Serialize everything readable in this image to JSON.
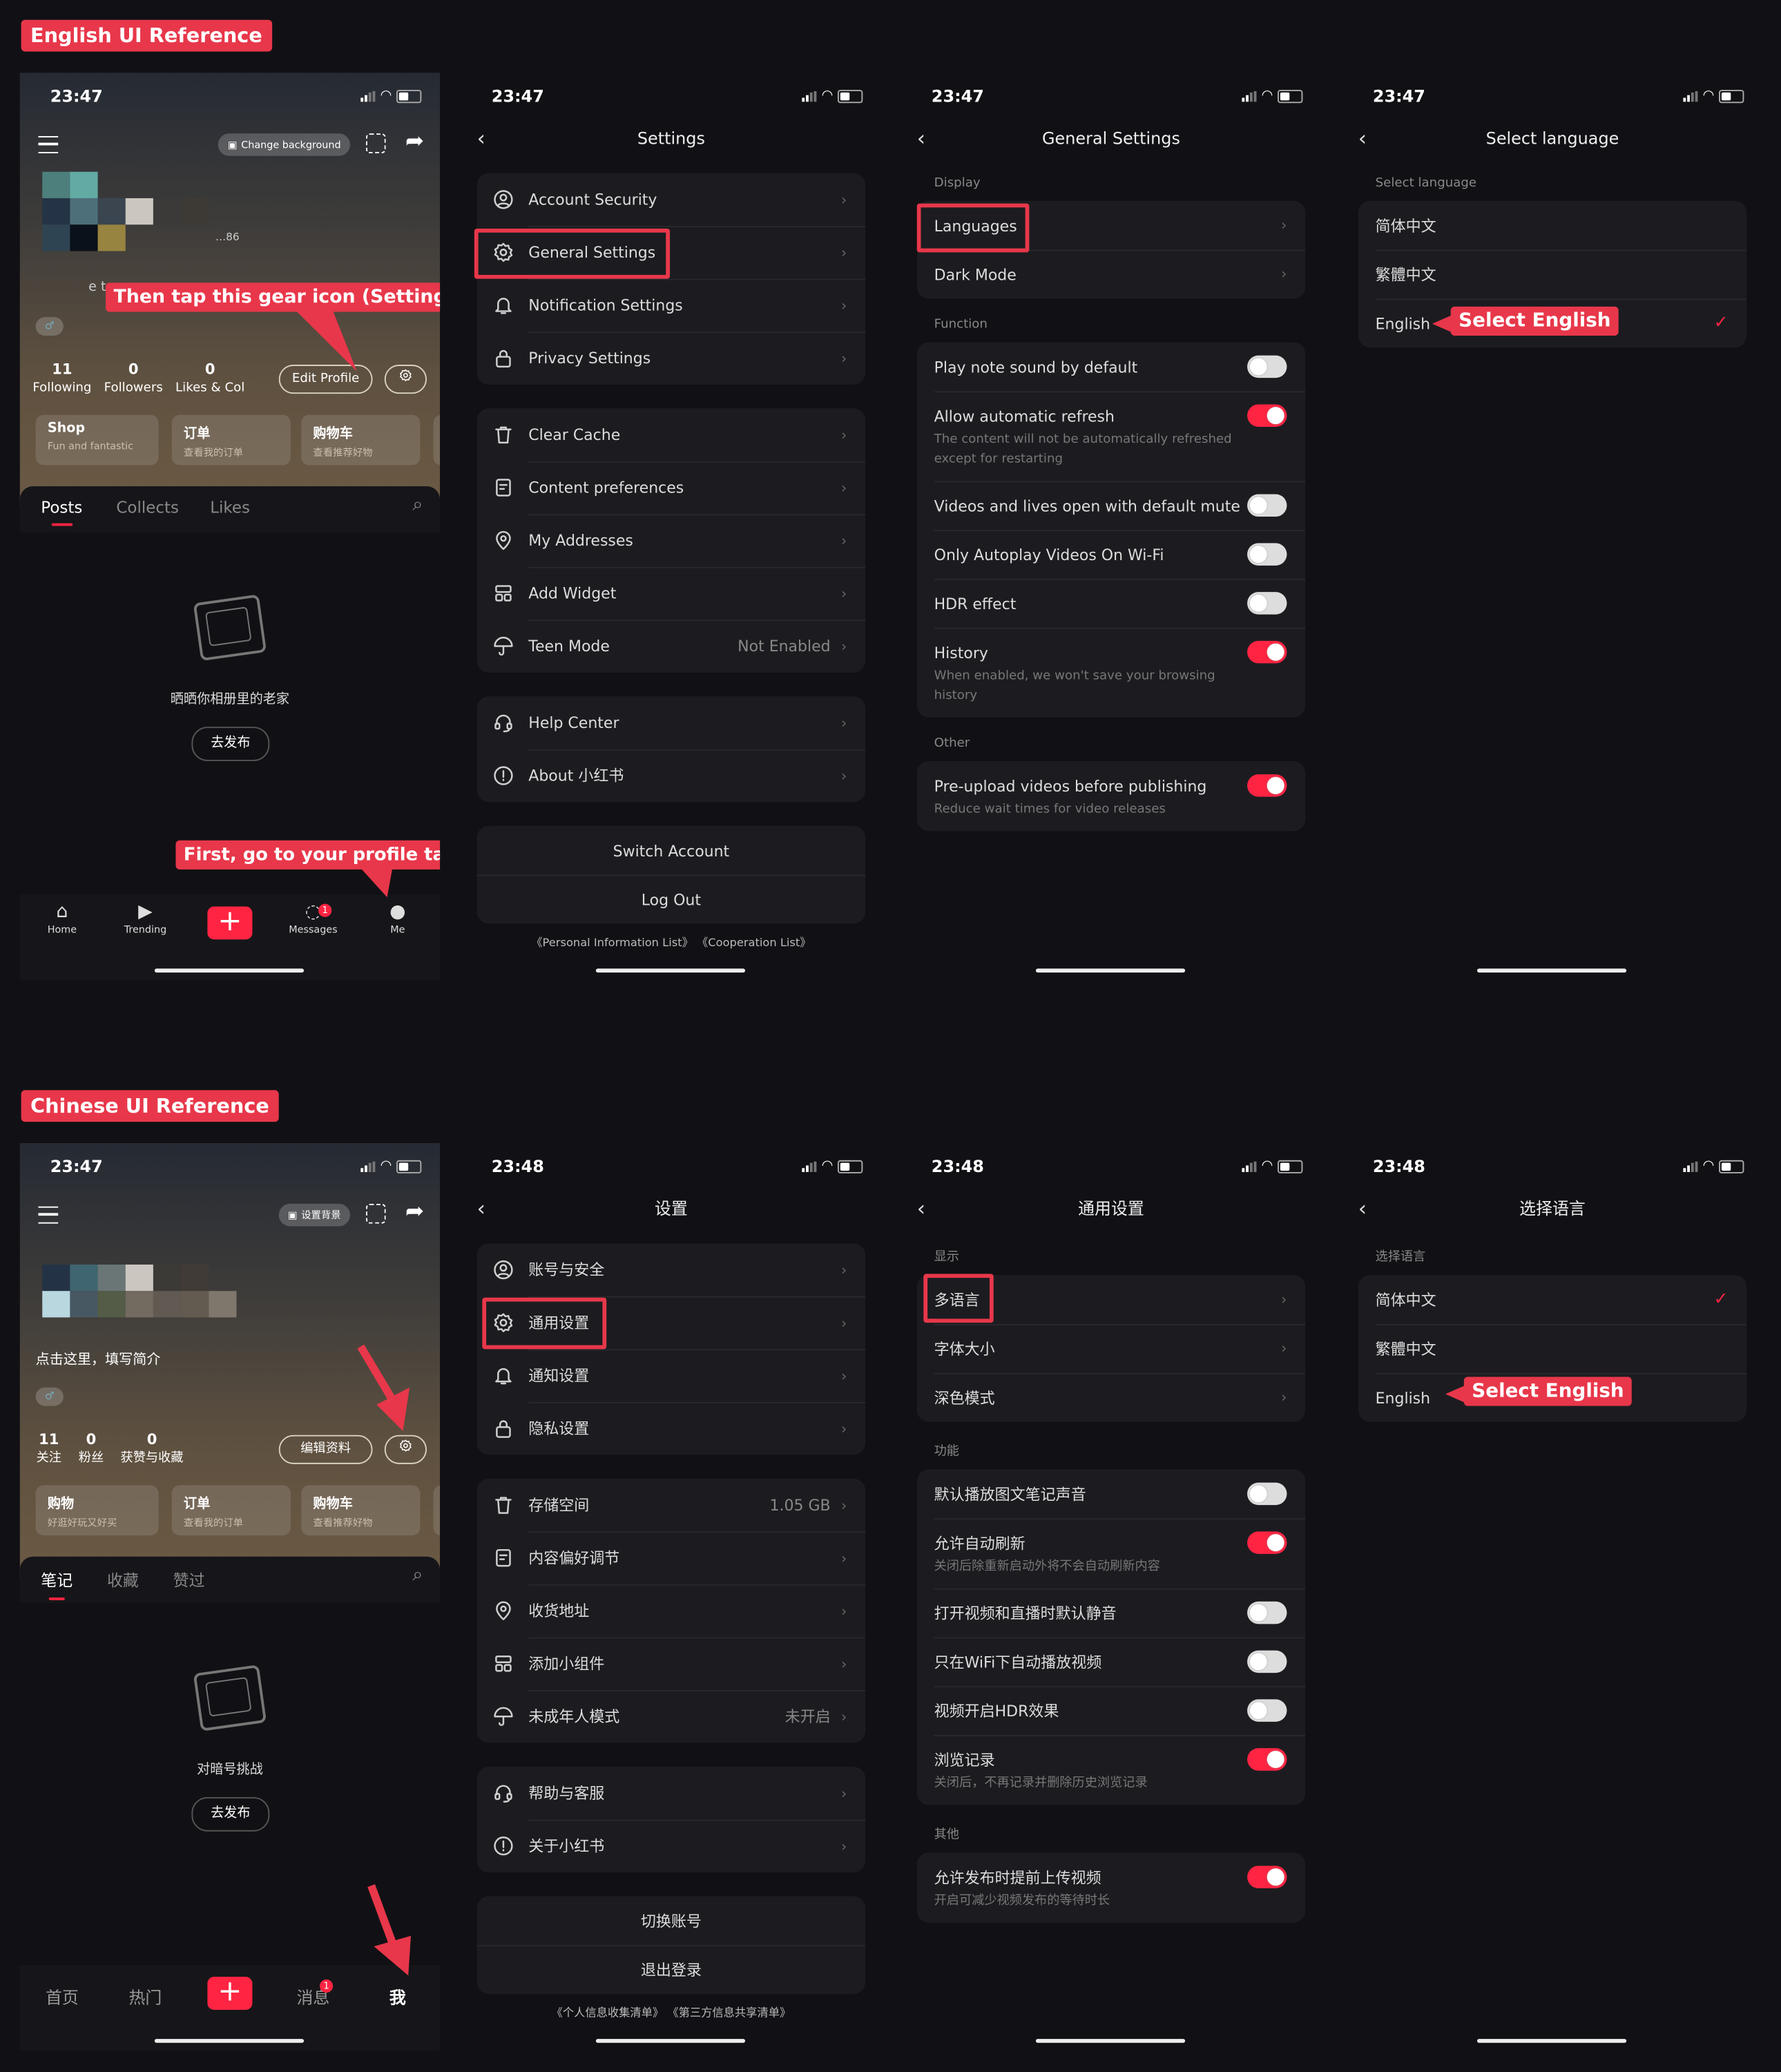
{
  "labels": {
    "english": "English UI Reference",
    "chinese": "Chinese UI Reference"
  },
  "colors": {
    "callout": "#e8374a",
    "toggle_on": "#ff2442",
    "card": "#1c1c20",
    "background": "#111115"
  },
  "en": {
    "profile": {
      "time": "23:47",
      "change_bg": "Change background",
      "handle_fragment": "…86",
      "bio_fragment": "e t",
      "stats": [
        {
          "n": "11",
          "l": "Following"
        },
        {
          "n": "0",
          "l": "Followers"
        },
        {
          "n": "0",
          "l": "Likes & Col"
        }
      ],
      "edit": "Edit Profile",
      "cards": [
        {
          "t": "Shop",
          "s": "Fun and fantastic"
        },
        {
          "t": "订单",
          "s": "查看我的订单"
        },
        {
          "t": "购物车",
          "s": "查看推荐好物"
        }
      ],
      "tabs": [
        "Posts",
        "Collects",
        "Likes"
      ],
      "empty_text": "晒晒你相册里的老家",
      "post_btn": "去发布",
      "nav": [
        {
          "l": "Home",
          "icon": "home-icon"
        },
        {
          "l": "Trending",
          "icon": "play-circle-icon"
        },
        {
          "l": "Messages",
          "icon": "chat-icon"
        },
        {
          "l": "Me",
          "icon": "person-icon"
        }
      ],
      "badge": "1",
      "callout_gear": "Then tap this gear icon (Settings)",
      "callout_me": "First, go to your profile tab"
    },
    "settings": {
      "time": "23:47",
      "title": "Settings",
      "groups": [
        [
          {
            "l": "Account Security",
            "icon": "account-security-icon"
          },
          {
            "l": "General Settings",
            "icon": "gear-icon"
          },
          {
            "l": "Notification Settings",
            "icon": "bell-icon"
          },
          {
            "l": "Privacy Settings",
            "icon": "lock-icon"
          }
        ],
        [
          {
            "l": "Clear Cache",
            "icon": "trash-icon"
          },
          {
            "l": "Content preferences",
            "icon": "document-icon"
          },
          {
            "l": "My Addresses",
            "icon": "location-pin-icon"
          },
          {
            "l": "Add Widget",
            "icon": "widget-icon"
          },
          {
            "l": "Teen Mode",
            "icon": "umbrella-icon",
            "v": "Not Enabled"
          }
        ],
        [
          {
            "l": "Help Center",
            "icon": "headset-icon"
          },
          {
            "l": "About 小红书",
            "icon": "info-icon"
          }
        ]
      ],
      "actions": [
        "Switch Account",
        "Log Out"
      ],
      "footer": "《Personal Information List》 《Cooperation List》"
    },
    "general": {
      "time": "23:47",
      "title": "General Settings",
      "sections": [
        {
          "label": "Display",
          "items": [
            {
              "l": "Languages",
              "type": "link"
            },
            {
              "l": "Dark Mode",
              "type": "link"
            }
          ]
        },
        {
          "label": "Function",
          "items": [
            {
              "l": "Play note sound by default",
              "type": "toggle",
              "on": false
            },
            {
              "l": "Allow automatic refresh",
              "type": "toggle",
              "on": true,
              "sub": "The content will not be automatically refreshed except for restarting"
            },
            {
              "l": "Videos and lives open with default mute",
              "type": "toggle",
              "on": false
            },
            {
              "l": "Only Autoplay Videos On Wi-Fi",
              "type": "toggle",
              "on": false
            },
            {
              "l": "HDR effect",
              "type": "toggle",
              "on": false
            },
            {
              "l": "History",
              "type": "toggle",
              "on": true,
              "sub": "When enabled,  we won't save your browsing history"
            }
          ]
        },
        {
          "label": "Other",
          "items": [
            {
              "l": "Pre-upload videos before publishing",
              "type": "toggle",
              "on": true,
              "sub": "Reduce wait times for video releases"
            }
          ]
        }
      ]
    },
    "language": {
      "time": "23:47",
      "title": "Select language",
      "section": "Select language",
      "options": [
        {
          "l": "简体中文",
          "checked": false
        },
        {
          "l": "繁體中文",
          "checked": false
        },
        {
          "l": "English",
          "checked": true
        }
      ],
      "callout": "Select English"
    }
  },
  "zh": {
    "profile": {
      "time": "23:47",
      "change_bg": "设置背景",
      "bio": "点击这里，填写简介",
      "stats": [
        {
          "n": "11",
          "l": "关注"
        },
        {
          "n": "0",
          "l": "粉丝"
        },
        {
          "n": "0",
          "l": "获赞与收藏"
        }
      ],
      "edit": "编辑资料",
      "cards": [
        {
          "t": "购物",
          "s": "好逛好玩又好买"
        },
        {
          "t": "订单",
          "s": "查看我的订单"
        },
        {
          "t": "购物车",
          "s": "查看推荐好物"
        }
      ],
      "tabs": [
        "笔记",
        "收藏",
        "赞过"
      ],
      "empty_text": "对暗号挑战",
      "post_btn": "去发布",
      "nav": [
        {
          "l": "首页"
        },
        {
          "l": "热门"
        },
        {
          "l": "消息"
        },
        {
          "l": "我"
        }
      ],
      "badge": "1"
    },
    "settings": {
      "time": "23:48",
      "title": "设置",
      "groups": [
        [
          {
            "l": "账号与安全",
            "icon": "account-security-icon"
          },
          {
            "l": "通用设置",
            "icon": "gear-icon"
          },
          {
            "l": "通知设置",
            "icon": "bell-icon"
          },
          {
            "l": "隐私设置",
            "icon": "lock-icon"
          }
        ],
        [
          {
            "l": "存储空间",
            "icon": "trash-icon",
            "v": "1.05 GB"
          },
          {
            "l": "内容偏好调节",
            "icon": "document-icon"
          },
          {
            "l": "收货地址",
            "icon": "location-pin-icon"
          },
          {
            "l": "添加小组件",
            "icon": "widget-icon"
          },
          {
            "l": "未成年人模式",
            "icon": "umbrella-icon",
            "v": "未开启"
          }
        ],
        [
          {
            "l": "帮助与客服",
            "icon": "headset-icon"
          },
          {
            "l": "关于小红书",
            "icon": "info-icon"
          }
        ]
      ],
      "actions": [
        "切换账号",
        "退出登录"
      ],
      "footer": "《个人信息收集清单》 《第三方信息共享清单》"
    },
    "general": {
      "time": "23:48",
      "title": "通用设置",
      "sections": [
        {
          "label": "显示",
          "items": [
            {
              "l": "多语言",
              "type": "link"
            },
            {
              "l": "字体大小",
              "type": "link"
            },
            {
              "l": "深色模式",
              "type": "link"
            }
          ]
        },
        {
          "label": "功能",
          "items": [
            {
              "l": "默认播放图文笔记声音",
              "type": "toggle",
              "on": false
            },
            {
              "l": "允许自动刷新",
              "type": "toggle",
              "on": true,
              "sub": "关闭后除重新启动外将不会自动刷新内容"
            },
            {
              "l": "打开视频和直播时默认静音",
              "type": "toggle",
              "on": false
            },
            {
              "l": "只在WiFi下自动播放视频",
              "type": "toggle",
              "on": false
            },
            {
              "l": "视频开启HDR效果",
              "type": "toggle",
              "on": false
            },
            {
              "l": "浏览记录",
              "type": "toggle",
              "on": true,
              "sub": "关闭后，不再记录并删除历史浏览记录"
            }
          ]
        },
        {
          "label": "其他",
          "items": [
            {
              "l": "允许发布时提前上传视频",
              "type": "toggle",
              "on": true,
              "sub": "开启可减少视频发布的等待时长"
            }
          ]
        }
      ]
    },
    "language": {
      "time": "23:48",
      "title": "选择语言",
      "section": "选择语言",
      "options": [
        {
          "l": "简体中文",
          "checked": true
        },
        {
          "l": "繁體中文",
          "checked": false
        },
        {
          "l": "English",
          "checked": false
        }
      ],
      "callout": "Select English"
    }
  }
}
